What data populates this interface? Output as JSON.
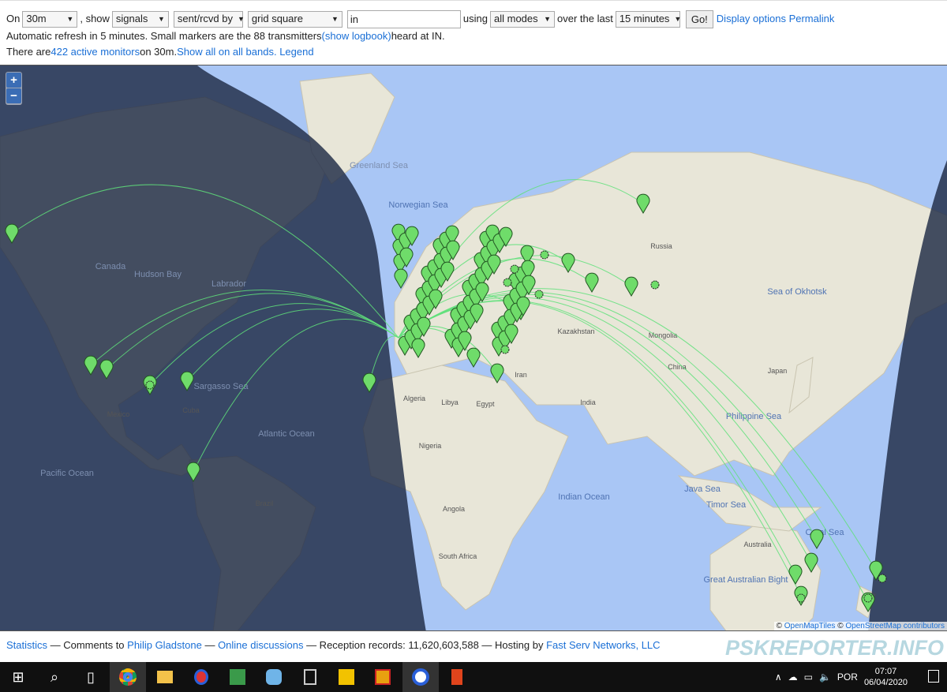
{
  "controls": {
    "on_label": "On",
    "band": "30m",
    "show_label": ", show",
    "show": "signals",
    "direction": "sent/rcvd by",
    "filter_type": "grid square",
    "filter_value": "in",
    "using_label": "using",
    "mode": "all modes",
    "over_label": "over the last",
    "period": "15 minutes",
    "go": "Go!",
    "display_options": "Display options",
    "permalink": "Permalink"
  },
  "status": {
    "line1_pre": "Automatic refresh in 5 minutes. Small markers are the 88 transmitters ",
    "show_logbook": "(show logbook)",
    "line1_post": " heard at IN.",
    "line2_pre": "There are ",
    "active_monitors": "422 active monitors",
    "line2_mid": " on 30m. ",
    "show_all": "Show all on all bands.",
    "legend": "Legend"
  },
  "map": {
    "zoom_in": "+",
    "zoom_out": "−",
    "attribution_pre": "© ",
    "openmaptiles": "OpenMapTiles",
    "attribution_mid": " © ",
    "openstreetmap": "OpenStreetMap contributors",
    "colors": {
      "ocean": "#a9c6f5",
      "land": "#e8e6d8",
      "night": "#1f2b45",
      "path": "#5fe07a",
      "marker": "#6fdc6a"
    },
    "labels": [
      "Greenland Sea",
      "Norwegian Sea",
      "Hudson Bay",
      "Labrador",
      "Canada",
      "Sargasso Sea",
      "Atlantic Ocean",
      "Pacific Ocean",
      "Sea of Okhotsk",
      "Philippine Sea",
      "Indian Ocean",
      "Java Sea",
      "Timor Sea",
      "Coral Sea",
      "Great Australian Bight",
      "Russia",
      "Kazakhstan",
      "Mongolia",
      "China",
      "India",
      "Algeria",
      "Libya",
      "Egypt",
      "Nigeria",
      "Brazil",
      "Australia",
      "Japan",
      "Iran",
      "Mexico",
      "Cuba",
      "South Africa",
      "Angola"
    ]
  },
  "footer": {
    "statistics": "Statistics",
    "t1": " — Comments to ",
    "author": "Philip Gladstone",
    "t2": " — ",
    "discussions": "Online discussions",
    "t3": " — Reception records: 11,620,603,588 — Hosting by ",
    "host": "Fast Serv Networks, LLC",
    "logo": "PSKREPORTER.INFO"
  },
  "taskbar": {
    "lang": "POR",
    "time": "07:07",
    "date": "06/04/2020",
    "icons": [
      "windows-start",
      "search",
      "task-view",
      "chrome",
      "file-explorer",
      "app",
      "app",
      "app",
      "app",
      "app",
      "app",
      "app",
      "app"
    ]
  }
}
